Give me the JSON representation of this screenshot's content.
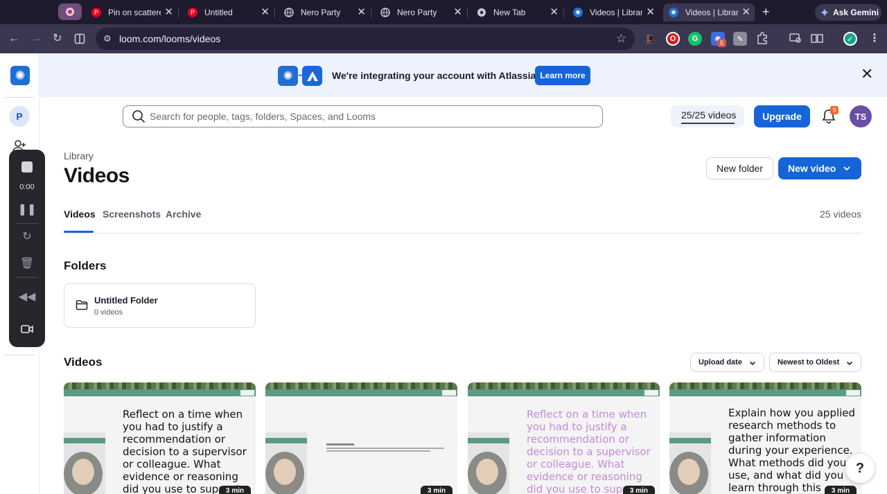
{
  "browser": {
    "tabs": [
      {
        "title": "Pin on scattered"
      },
      {
        "title": "Untitled"
      },
      {
        "title": "Nero Party"
      },
      {
        "title": "Nero Party"
      },
      {
        "title": "New Tab"
      },
      {
        "title": "Videos | Library"
      },
      {
        "title": "Videos | Library"
      }
    ],
    "new_tab_symbol": "+",
    "gemini_label": "Ask Gemini",
    "url": "loom.com/looms/videos",
    "extension_badge": "5"
  },
  "banner": {
    "message": "We're integrating your account with Atlassian.",
    "learn_more": "Learn more"
  },
  "sidebar": {
    "workspace_initial": "P"
  },
  "recorder": {
    "time": "0:00"
  },
  "header": {
    "search_placeholder": "Search for people, tags, folders, Spaces, and Looms",
    "quota": "25/25 videos",
    "quota_fraction": 1.0,
    "upgrade": "Upgrade",
    "notification_count": "9",
    "user_initials": "TS"
  },
  "page": {
    "breadcrumb": "Library",
    "title": "Videos",
    "new_folder": "New folder",
    "new_video": "New video",
    "tabs": [
      {
        "label": "Videos"
      },
      {
        "label": "Screenshots"
      },
      {
        "label": "Archive"
      }
    ],
    "video_count": "25 videos"
  },
  "folders": {
    "heading": "Folders",
    "items": [
      {
        "name": "Untitled Folder",
        "count": "0 videos"
      }
    ]
  },
  "videos": {
    "heading": "Videos",
    "sort_by": "Upload date",
    "sort_order": "Newest to Oldest",
    "cards": [
      {
        "prompt": "Reflect on a time when you had to justify a recommendation or decision to a supervisor or colleague. What evidence or reasoning did you use to support your position?",
        "duration": "3 min"
      },
      {
        "prompt": "",
        "duration": "3 min"
      },
      {
        "prompt": "Reflect on a time when you had to justify a recommendation or decision to a supervisor or colleague. What evidence or reasoning did you use to support your position?",
        "duration": "3 min"
      },
      {
        "prompt": "Explain how you applied research methods to gather information during your experience. What methods did you use, and what did you learn through this process?",
        "duration": "3 min"
      }
    ]
  },
  "help_label": "?",
  "colors": {
    "accent": "#1565d8",
    "banner_bg": "#edf2fc",
    "avatar": "#6a4ea8",
    "badge": "#f5672a"
  }
}
